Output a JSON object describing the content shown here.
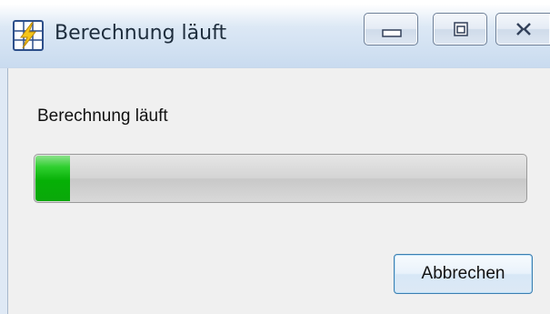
{
  "window": {
    "title": "Berechnung läuft",
    "icon": "lightning-grid-icon"
  },
  "controls": {
    "minimize_icon": "minimize-icon",
    "maximize_icon": "maximize-icon",
    "close_icon": "close-icon"
  },
  "content": {
    "message": "Berechnung läuft",
    "progress_percent": 7,
    "progress_color": "#06b006",
    "cancel_label": "Abbrechen"
  }
}
